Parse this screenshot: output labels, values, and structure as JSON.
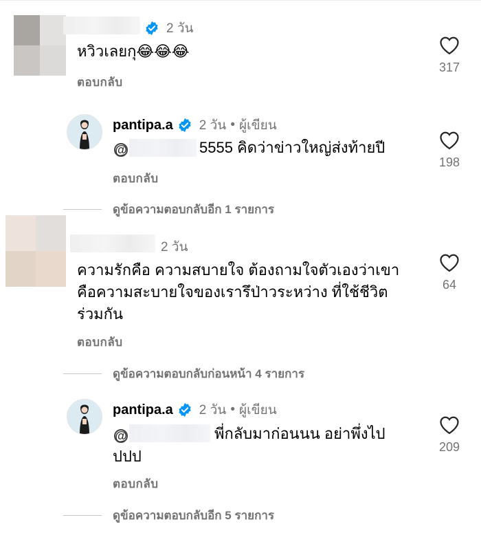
{
  "comments": [
    {
      "time": "2 วัน",
      "text": "หวิวเลยกุ😂😂😂",
      "reply_label": "ตอบกลับ",
      "likes": "317"
    },
    {
      "username": "pantipa.a",
      "time": "2 วัน",
      "separator": "•",
      "author_badge": "ผู้เขียน",
      "text": "5555 คิดว่าข่าวใหญ่ส่งท้ายปี",
      "reply_label": "ตอบกลับ",
      "likes": "198",
      "more_replies": "ดูข้อความตอบกลับอีก 1 รายการ"
    },
    {
      "time": "2 วัน",
      "text_line1": "ความรักคือ ความสบายใจ ต้องถามใจตัวเองว่าเขา",
      "text_line2": "คือความสะบายใจของเรารึป่าวระหว่าง ที่ใช้ชีวิต",
      "text_line3": "ร่วมกัน",
      "reply_label": "ตอบกลับ",
      "likes": "64",
      "more_replies": "ดูข้อความตอบกลับก่อนหน้า 4 รายการ"
    },
    {
      "username": "pantipa.a",
      "time": "2 วัน",
      "separator": "•",
      "author_badge": "ผู้เขียน",
      "text_line1": "พี่กลับมาก่อนนน อย่าพึ่งไป",
      "text_line2": "ปปป",
      "reply_label": "ตอบกลับ",
      "likes": "209",
      "more_replies": "ดูข้อความตอบกลับอีก 5 รายการ"
    }
  ],
  "icons": {
    "like": "heart-icon",
    "verified": "verified-badge-icon",
    "mention": "threads-icon"
  },
  "colors": {
    "verified": "#0095f6",
    "muted": "#737373"
  }
}
